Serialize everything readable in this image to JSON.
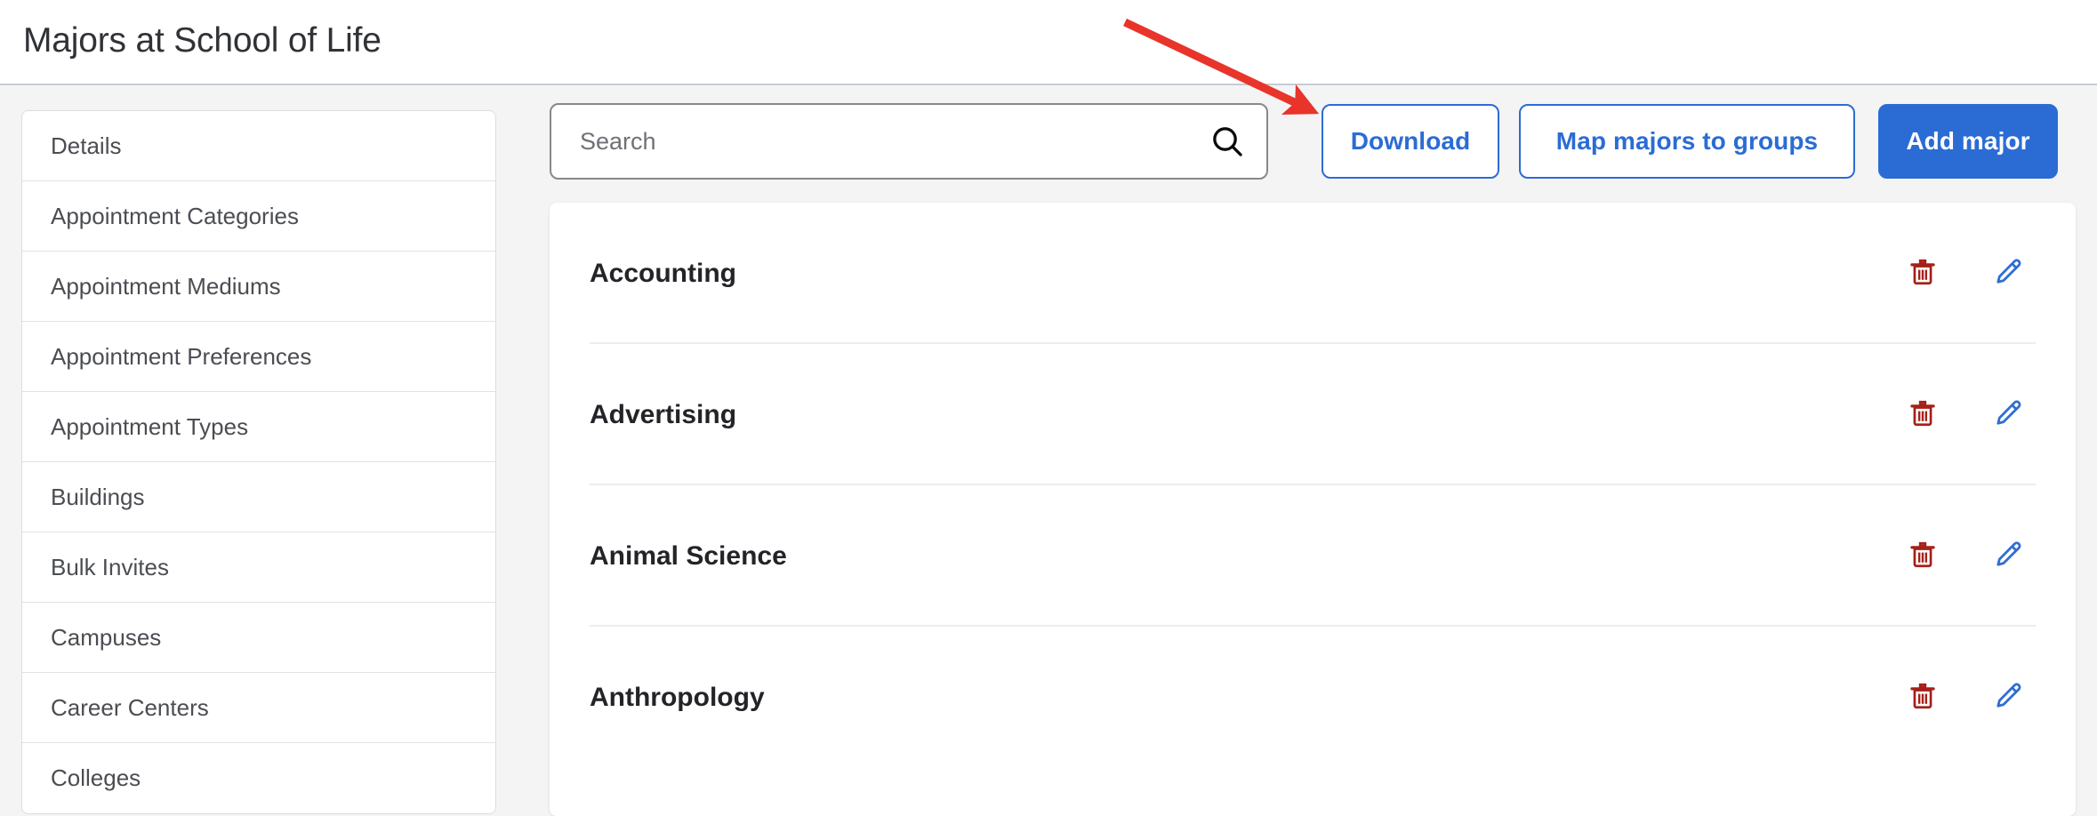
{
  "header": {
    "title": "Majors at School of Life"
  },
  "sidebar": {
    "items": [
      {
        "label": "Details"
      },
      {
        "label": "Appointment Categories"
      },
      {
        "label": "Appointment Mediums"
      },
      {
        "label": "Appointment Preferences"
      },
      {
        "label": "Appointment Types"
      },
      {
        "label": "Buildings"
      },
      {
        "label": "Bulk Invites"
      },
      {
        "label": "Campuses"
      },
      {
        "label": "Career Centers"
      },
      {
        "label": "Colleges"
      }
    ]
  },
  "toolbar": {
    "search": {
      "placeholder": "Search",
      "value": "",
      "icon": "search-icon"
    },
    "download_label": "Download",
    "map_label": "Map majors to groups",
    "add_label": "Add major"
  },
  "main": {
    "rows": [
      {
        "name": "Accounting",
        "delete_icon": "trash-icon",
        "edit_icon": "pencil-icon"
      },
      {
        "name": "Advertising",
        "delete_icon": "trash-icon",
        "edit_icon": "pencil-icon"
      },
      {
        "name": "Animal Science",
        "delete_icon": "trash-icon",
        "edit_icon": "pencil-icon"
      },
      {
        "name": "Anthropology",
        "delete_icon": "trash-icon",
        "edit_icon": "pencil-icon"
      }
    ]
  },
  "annotation": {
    "type": "red-arrow",
    "points_to": "Download",
    "color": "#e8342a"
  },
  "colors": {
    "accent_blue": "#2b6cd4",
    "delete_red": "#a52019",
    "edit_blue": "#2f6fd0",
    "page_background": "#f4f4f5",
    "card_background": "#ffffff",
    "annotation_red": "#e8342a"
  }
}
